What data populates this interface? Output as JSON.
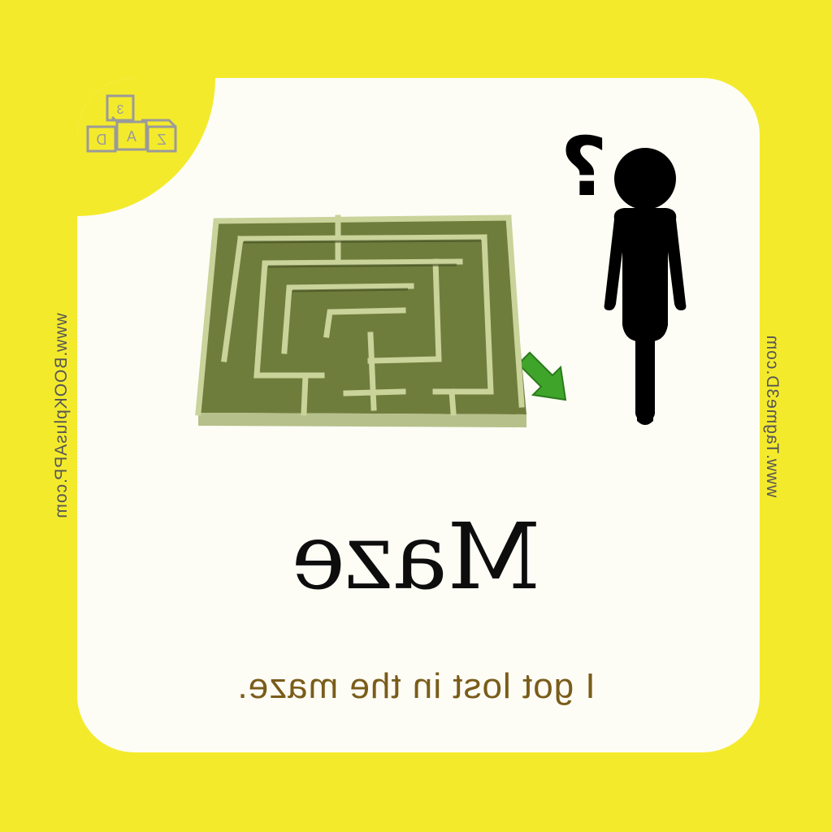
{
  "card": {
    "word": "Maze",
    "sentence": "I got lost in the maze."
  },
  "side_urls": {
    "left": "www.BOOKplusAPP.com",
    "right": "www.Tagme3D.com"
  },
  "logo": {
    "icon": "alphabet-blocks-icon",
    "letters": [
      "Z",
      "A",
      "D",
      "3"
    ]
  },
  "illustration": {
    "maze": "maze-icon",
    "arrow": "green-arrow-icon",
    "person": "person-silhouette-icon",
    "question": "?"
  },
  "colors": {
    "background": "#f4ea2c",
    "card": "#fdfdf6",
    "maze": "#6b7a3a",
    "arrow": "#3fa52a",
    "sentence": "#7a5c1a"
  }
}
